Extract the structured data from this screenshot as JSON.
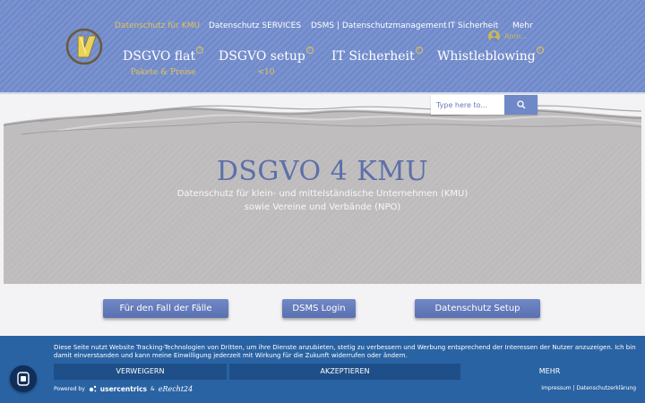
{
  "top_nav": [
    {
      "label": "Datenschutz für KMU",
      "active": true
    },
    {
      "label": "Datenschutz SERVICES",
      "active": false
    },
    {
      "label": "DSMS | Datenschutzmanagement",
      "active": false
    },
    {
      "label": "IT Sicherheit",
      "active": false
    },
    {
      "label": "Mehr",
      "active": false
    }
  ],
  "auth": {
    "label": "Anm..."
  },
  "main_nav": [
    {
      "label": "DSGVO flat",
      "sub": "Pakete & Preise ",
      "info": "i"
    },
    {
      "label": "DSGVO setup",
      "sub": " <10 ",
      "info": "i"
    },
    {
      "label": "IT Sicherheit",
      "sub": "",
      "info": "i"
    },
    {
      "label": "Whistleblowing",
      "sub": "",
      "info": "i"
    }
  ],
  "search": {
    "placeholder": "Type here to..."
  },
  "hero": {
    "title": "DSGVO 4 KMU",
    "subtitle_line1": "Datenschutz für klein- und mittelständische Unternehmen (KMU)",
    "subtitle_line2": "sowie Vereine und Verbände (NPO)"
  },
  "cta_buttons": [
    {
      "label": "Für den Fall der Fälle"
    },
    {
      "label": "DSMS Login"
    },
    {
      "label": "Datenschutz Setup"
    }
  ],
  "consent": {
    "text": "Diese Seite nutzt Website Tracking-Technologien von Dritten, um ihre Dienste anzubieten, stetig zu verbessern und Werbung entsprechend der Interessen der Nutzer anzuzeigen. Ich bin damit einverstanden und kann meine Einwilligung jederzeit mit Wirkung für die Zukunft widerrufen oder ändern.",
    "deny_label": "VERWEIGERN",
    "accept_label": "AKZEPTIEREN",
    "more_label": "MEHR",
    "powered_by": "Powered by",
    "provider1": "usercentrics",
    "ampersand": "&",
    "provider2": "eRecht24",
    "legal_links": "Impressum | Datenschutzerklärung"
  },
  "colors": {
    "header_blue": "#7a93d0",
    "accent_gold": "#e2c35a",
    "hero_title": "#5d6fa8",
    "banner_blue": "#2a63a3"
  }
}
